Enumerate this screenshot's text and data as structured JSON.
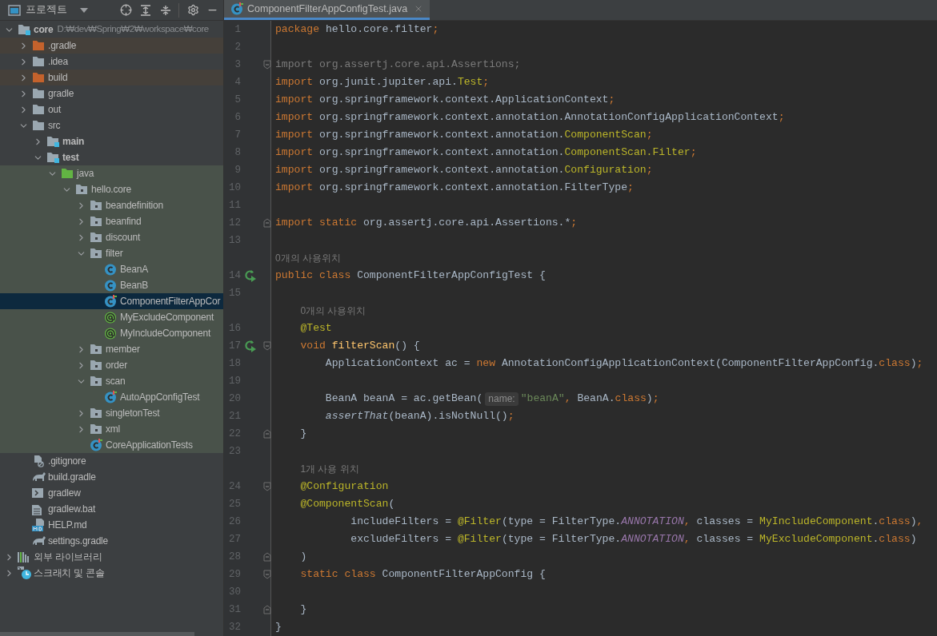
{
  "project_panel": {
    "title": "프로젝트",
    "tree": [
      {
        "name": "core",
        "kind": "module",
        "path": "D:₩dev₩Spring₩2₩workspace₩core",
        "expanded": true,
        "selected": false,
        "children": [
          {
            "name": ".gradle",
            "kind": "folder",
            "excluded": true,
            "expanded": false,
            "selected": false
          },
          {
            "name": ".idea",
            "kind": "folder",
            "excluded": false,
            "expanded": false,
            "selected": false
          },
          {
            "name": "build",
            "kind": "folder",
            "excluded": true,
            "expanded": false,
            "selected": false
          },
          {
            "name": "gradle",
            "kind": "folder",
            "excluded": false,
            "expanded": false,
            "selected": false
          },
          {
            "name": "out",
            "kind": "folder",
            "excluded": false,
            "expanded": false,
            "selected": false
          },
          {
            "name": "src",
            "kind": "folder",
            "excluded": false,
            "expanded": true,
            "selected": false,
            "children": [
              {
                "name": "main",
                "kind": "module",
                "expanded": false,
                "selected": false
              },
              {
                "name": "test",
                "kind": "module",
                "expanded": true,
                "selected": false,
                "children": [
                  {
                    "name": "java",
                    "kind": "test-root",
                    "expanded": true,
                    "selected": false,
                    "children": [
                      {
                        "name": "hello.core",
                        "kind": "package",
                        "expanded": true,
                        "selected": false,
                        "children": [
                          {
                            "name": "beandefinition",
                            "kind": "package",
                            "expanded": false,
                            "selected": false
                          },
                          {
                            "name": "beanfind",
                            "kind": "package",
                            "expanded": false,
                            "selected": false
                          },
                          {
                            "name": "discount",
                            "kind": "package",
                            "expanded": false,
                            "selected": false
                          },
                          {
                            "name": "filter",
                            "kind": "package",
                            "expanded": true,
                            "selected": false,
                            "children": [
                              {
                                "name": "BeanA",
                                "kind": "class",
                                "selected": false
                              },
                              {
                                "name": "BeanB",
                                "kind": "class",
                                "selected": false
                              },
                              {
                                "name": "ComponentFilterAppCor",
                                "kind": "test-class",
                                "selected": true
                              },
                              {
                                "name": "MyExcludeComponent",
                                "kind": "annotation",
                                "selected": false
                              },
                              {
                                "name": "MyIncludeComponent",
                                "kind": "annotation",
                                "selected": false
                              }
                            ]
                          },
                          {
                            "name": "member",
                            "kind": "package",
                            "expanded": false,
                            "selected": false
                          },
                          {
                            "name": "order",
                            "kind": "package",
                            "expanded": false,
                            "selected": false
                          },
                          {
                            "name": "scan",
                            "kind": "package",
                            "expanded": true,
                            "selected": false,
                            "children": [
                              {
                                "name": "AutoAppConfigTest",
                                "kind": "test-class",
                                "selected": false
                              }
                            ]
                          },
                          {
                            "name": "singletonTest",
                            "kind": "package",
                            "expanded": false,
                            "selected": false
                          },
                          {
                            "name": "xml",
                            "kind": "package",
                            "expanded": false,
                            "selected": false
                          },
                          {
                            "name": "CoreApplicationTests",
                            "kind": "test-class",
                            "selected": false
                          }
                        ]
                      }
                    ]
                  }
                ]
              }
            ]
          },
          {
            "name": ".gitignore",
            "kind": "ignore-file",
            "selected": false
          },
          {
            "name": "build.gradle",
            "kind": "gradle-file",
            "selected": false
          },
          {
            "name": "gradlew",
            "kind": "shell-file",
            "selected": false
          },
          {
            "name": "gradlew.bat",
            "kind": "text-file",
            "selected": false
          },
          {
            "name": "HELP.md",
            "kind": "md-file",
            "selected": false
          },
          {
            "name": "settings.gradle",
            "kind": "gradle-file",
            "selected": false
          }
        ]
      },
      {
        "name": "외부 라이브러리",
        "kind": "libraries",
        "expanded": false,
        "selected": false
      },
      {
        "name": "스크래치 및 콘솔",
        "kind": "scratches",
        "expanded": false,
        "selected": false
      }
    ]
  },
  "editor": {
    "tabs": [
      {
        "title": "ComponentFilterAppConfigTest.java",
        "selected": true
      }
    ],
    "lines": [
      {
        "number": "1",
        "tokens": [
          {
            "kind": "keyword",
            "text": "package "
          },
          {
            "kind": "plain",
            "text": "hello.core.filter"
          },
          {
            "kind": "keyword",
            "text": ";"
          }
        ]
      },
      {
        "number": "2"
      },
      {
        "number": "3",
        "fold_marker": {
          "kind": "start"
        },
        "tokens": [
          {
            "kind": "unused",
            "text": "import org.assertj.core.api.Assertions;"
          }
        ]
      },
      {
        "number": "4",
        "tokens": [
          {
            "kind": "keyword",
            "text": "import "
          },
          {
            "kind": "plain",
            "text": "org.junit.jupiter.api."
          },
          {
            "kind": "annotation",
            "text": "Test"
          },
          {
            "kind": "keyword",
            "text": ";"
          }
        ]
      },
      {
        "number": "5",
        "tokens": [
          {
            "kind": "keyword",
            "text": "import "
          },
          {
            "kind": "plain",
            "text": "org.springframework.context.ApplicationContext"
          },
          {
            "kind": "keyword",
            "text": ";"
          }
        ]
      },
      {
        "number": "6",
        "tokens": [
          {
            "kind": "keyword",
            "text": "import "
          },
          {
            "kind": "plain",
            "text": "org.springframework.context.annotation.AnnotationConfigApplicationContext"
          },
          {
            "kind": "keyword",
            "text": ";"
          }
        ]
      },
      {
        "number": "7",
        "tokens": [
          {
            "kind": "keyword",
            "text": "import "
          },
          {
            "kind": "plain",
            "text": "org.springframework.context.annotation."
          },
          {
            "kind": "annotation",
            "text": "ComponentScan"
          },
          {
            "kind": "keyword",
            "text": ";"
          }
        ]
      },
      {
        "number": "8",
        "tokens": [
          {
            "kind": "keyword",
            "text": "import "
          },
          {
            "kind": "plain",
            "text": "org.springframework.context.annotation."
          },
          {
            "kind": "annotation",
            "text": "ComponentScan.Filter"
          },
          {
            "kind": "keyword",
            "text": ";"
          }
        ]
      },
      {
        "number": "9",
        "tokens": [
          {
            "kind": "keyword",
            "text": "import "
          },
          {
            "kind": "plain",
            "text": "org.springframework.context.annotation."
          },
          {
            "kind": "annotation",
            "text": "Configuration"
          },
          {
            "kind": "keyword",
            "text": ";"
          }
        ]
      },
      {
        "number": "10",
        "tokens": [
          {
            "kind": "keyword",
            "text": "import "
          },
          {
            "kind": "plain",
            "text": "org.springframework.context.annotation.FilterType"
          },
          {
            "kind": "keyword",
            "text": ";"
          }
        ]
      },
      {
        "number": "11"
      },
      {
        "number": "12",
        "fold_marker": {
          "kind": "end"
        },
        "tokens": [
          {
            "kind": "keyword",
            "text": "import static "
          },
          {
            "kind": "plain",
            "text": "org.assertj.core.api.Assertions.*"
          },
          {
            "kind": "keyword",
            "text": ";"
          }
        ]
      },
      {
        "number": "13"
      },
      {
        "number": "14",
        "hint": "0개의 사용위치",
        "gutter_icon": {
          "kind": "run"
        },
        "tokens": [
          {
            "kind": "keyword",
            "text": "public class "
          },
          {
            "kind": "plain",
            "text": "ComponentFilterAppConfigTest {"
          }
        ]
      },
      {
        "number": "15"
      },
      {
        "number": "16",
        "hint": "0개의 사용위치",
        "tokens": [
          {
            "kind": "annotation",
            "text": "    @Test"
          }
        ]
      },
      {
        "number": "17",
        "gutter_icon": {
          "kind": "run"
        },
        "fold_marker": {
          "kind": "start"
        },
        "tokens": [
          {
            "kind": "keyword",
            "text": "    void "
          },
          {
            "kind": "method",
            "text": "filterScan"
          },
          {
            "kind": "plain",
            "text": "() {"
          }
        ]
      },
      {
        "number": "18",
        "tokens": [
          {
            "kind": "plain",
            "text": "        ApplicationContext ac = "
          },
          {
            "kind": "keyword",
            "text": "new "
          },
          {
            "kind": "plain",
            "text": "AnnotationConfigApplicationContext(ComponentFilterAppConfig."
          },
          {
            "kind": "keyword",
            "text": "class"
          },
          {
            "kind": "plain",
            "text": ")"
          },
          {
            "kind": "keyword",
            "text": ";"
          }
        ]
      },
      {
        "number": "19"
      },
      {
        "number": "20",
        "tokens": [
          {
            "kind": "plain",
            "text": "        BeanA beanA = ac.getBean("
          },
          {
            "kind": "hint",
            "text": "name:"
          },
          {
            "kind": "string",
            "text": "\"beanA\""
          },
          {
            "kind": "keyword",
            "text": ", "
          },
          {
            "kind": "plain",
            "text": "BeanA."
          },
          {
            "kind": "keyword",
            "text": "class"
          },
          {
            "kind": "plain",
            "text": ")"
          },
          {
            "kind": "keyword",
            "text": ";"
          }
        ]
      },
      {
        "number": "21",
        "tokens": [
          {
            "kind": "static-call",
            "text": "        assertThat"
          },
          {
            "kind": "plain",
            "text": "(beanA).isNotNull()"
          },
          {
            "kind": "keyword",
            "text": ";"
          }
        ]
      },
      {
        "number": "22",
        "fold_marker": {
          "kind": "end"
        },
        "tokens": [
          {
            "kind": "plain",
            "text": "    }"
          }
        ]
      },
      {
        "number": "23"
      },
      {
        "number": "24",
        "hint": "1개 사용 위치",
        "fold_marker": {
          "kind": "start"
        },
        "tokens": [
          {
            "kind": "annotation",
            "text": "    @Configuration"
          }
        ]
      },
      {
        "number": "25",
        "tokens": [
          {
            "kind": "annotation",
            "text": "    @ComponentScan"
          },
          {
            "kind": "plain",
            "text": "("
          }
        ]
      },
      {
        "number": "26",
        "tokens": [
          {
            "kind": "plain",
            "text": "            includeFilters = "
          },
          {
            "kind": "annotation",
            "text": "@Filter"
          },
          {
            "kind": "plain",
            "text": "(type = FilterType."
          },
          {
            "kind": "constant",
            "text": "ANNOTATION"
          },
          {
            "kind": "keyword",
            "text": ", "
          },
          {
            "kind": "plain",
            "text": "classes = "
          },
          {
            "kind": "annotation",
            "text": "MyIncludeComponent"
          },
          {
            "kind": "plain",
            "text": "."
          },
          {
            "kind": "keyword",
            "text": "class"
          },
          {
            "kind": "plain",
            "text": ")"
          },
          {
            "kind": "keyword",
            "text": ","
          }
        ]
      },
      {
        "number": "27",
        "tokens": [
          {
            "kind": "plain",
            "text": "            excludeFilters = "
          },
          {
            "kind": "annotation",
            "text": "@Filter"
          },
          {
            "kind": "plain",
            "text": "(type = FilterType."
          },
          {
            "kind": "constant",
            "text": "ANNOTATION"
          },
          {
            "kind": "keyword",
            "text": ", "
          },
          {
            "kind": "plain",
            "text": "classes = "
          },
          {
            "kind": "annotation",
            "text": "MyExcludeComponent"
          },
          {
            "kind": "plain",
            "text": "."
          },
          {
            "kind": "keyword",
            "text": "class"
          },
          {
            "kind": "plain",
            "text": ")"
          }
        ]
      },
      {
        "number": "28",
        "fold_marker": {
          "kind": "end"
        },
        "tokens": [
          {
            "kind": "plain",
            "text": "    )"
          }
        ]
      },
      {
        "number": "29",
        "fold_marker": {
          "kind": "start"
        },
        "tokens": [
          {
            "kind": "keyword",
            "text": "    static class "
          },
          {
            "kind": "plain",
            "text": "ComponentFilterAppConfig {"
          }
        ]
      },
      {
        "number": "30"
      },
      {
        "number": "31",
        "fold_marker": {
          "kind": "end"
        },
        "tokens": [
          {
            "kind": "plain",
            "text": "    }"
          }
        ]
      },
      {
        "number": "32",
        "tokens": [
          {
            "kind": "plain",
            "text": "}"
          }
        ]
      }
    ]
  }
}
